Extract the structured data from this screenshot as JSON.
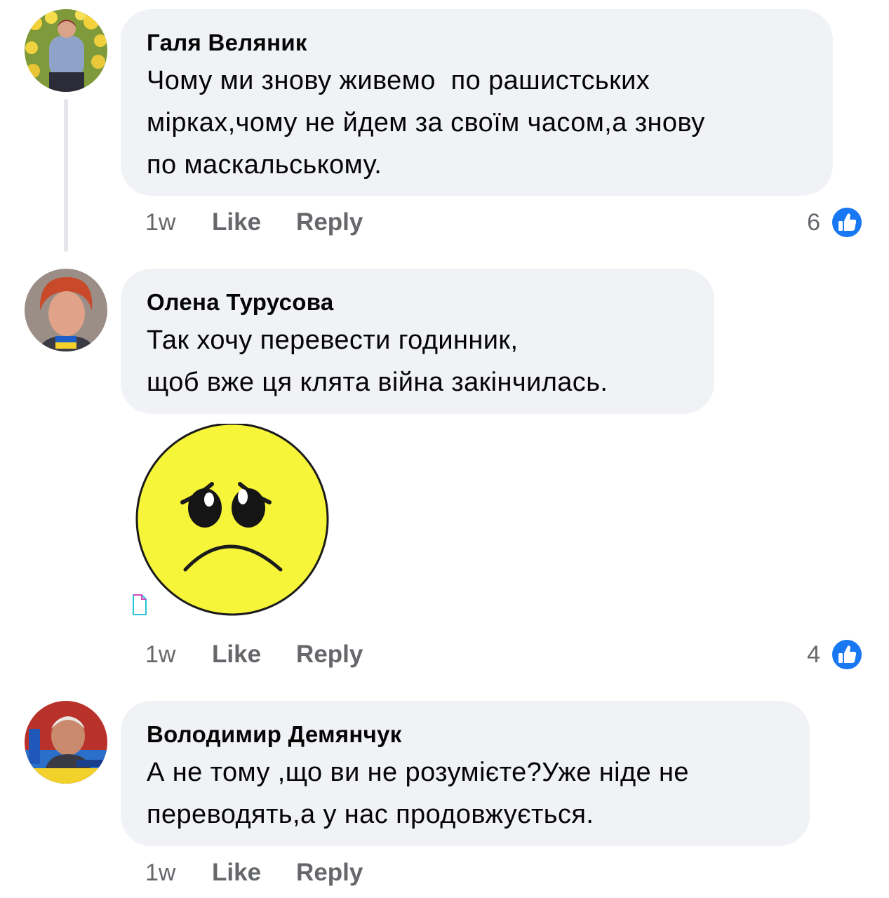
{
  "comments": [
    {
      "author": "Галя Веляник",
      "text": "Чому ми знову живемо  по рашистських\nмірках,чому не йдем за своїм часом,а знову\nпо маскальському.",
      "time": "1w",
      "like_label": "Like",
      "reply_label": "Reply",
      "reaction_count": "6"
    },
    {
      "author": "Олена Турусова",
      "text": "Так хочу перевести годинник,\nщоб вже ця клята війна закінчилась.",
      "time": "1w",
      "like_label": "Like",
      "reply_label": "Reply",
      "reaction_count": "4",
      "sticker": "sad-face-sticker"
    },
    {
      "author": "Володимир Демянчук",
      "text": "А не тому ,що ви не розумієте?Уже ніде не\nпереводять,а у нас продовжується.",
      "time": "1w",
      "like_label": "Like",
      "reply_label": "Reply"
    }
  ],
  "colors": {
    "bubble": "#f0f2f5",
    "secondary_text": "#65676b",
    "like_blue": "#1877f2",
    "sticker_yellow": "#f7f53a"
  }
}
